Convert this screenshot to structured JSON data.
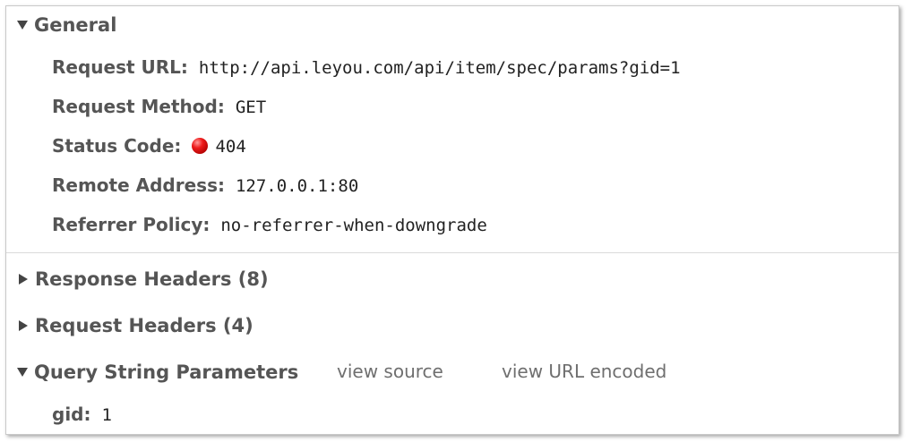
{
  "general": {
    "title": "General",
    "rows": [
      {
        "key": "Request URL:",
        "value": "http://api.leyou.com/api/item/spec/params?gid=1"
      },
      {
        "key": "Request Method:",
        "value": "GET"
      },
      {
        "key": "Status Code:",
        "value": "404"
      },
      {
        "key": "Remote Address:",
        "value": "127.0.0.1:80"
      },
      {
        "key": "Referrer Policy:",
        "value": "no-referrer-when-downgrade"
      }
    ]
  },
  "response_headers": {
    "title": "Response Headers (8)"
  },
  "request_headers": {
    "title": "Request Headers (4)"
  },
  "query_params": {
    "title": "Query String Parameters",
    "view_source": "view source",
    "view_url_encoded": "view URL encoded",
    "rows": [
      {
        "key": "gid:",
        "value": "1"
      }
    ]
  },
  "colors": {
    "status_error": "#ee1c1c",
    "section_title": "#555555",
    "link": "#6f6f6f"
  },
  "icons": {
    "expanded": "triangle-down-icon",
    "collapsed": "triangle-right-icon",
    "status": "red-status-dot-icon"
  }
}
